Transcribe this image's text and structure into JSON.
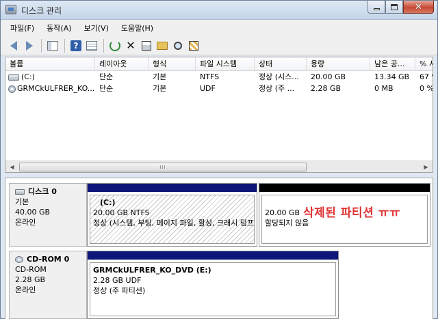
{
  "window": {
    "title": "디스크 관리"
  },
  "menu": [
    "파일(F)",
    "동작(A)",
    "보기(V)",
    "도움말(H)"
  ],
  "toolbar": {
    "icons": [
      "back-arrow-icon",
      "forward-arrow-icon",
      "console-tree-icon",
      "help-icon",
      "details-pane-icon",
      "refresh-icon",
      "delete-icon",
      "properties-icon",
      "open-icon",
      "explore-icon",
      "extend-icon"
    ]
  },
  "volume_table": {
    "columns": [
      "볼륨",
      "레이아웃",
      "형식",
      "파일 시스템",
      "상태",
      "용량",
      "남은 공...",
      "% 사용 가능"
    ],
    "rows": [
      [
        "(C:)",
        "단순",
        "기본",
        "NTFS",
        "정상 (시스...",
        "20.00 GB",
        "13.34 GB",
        "67 %"
      ],
      [
        "GRMCkULFRER_KO...",
        "단순",
        "기본",
        "UDF",
        "정상 (주 ...",
        "2.28 GB",
        "0 MB",
        "0 %"
      ]
    ],
    "scroll_thumb_label": "III"
  },
  "disks": [
    {
      "name": "디스크 0",
      "type": "기본",
      "size": "40.00 GB",
      "status": "온라인",
      "partitions": [
        {
          "title": "(C:)",
          "size": "20.00 GB NTFS",
          "status": "정상 (시스템, 부팅, 페이지 파일, 활성, 크래시 덤프, 주 파티션)"
        },
        {
          "size": "20.00 GB",
          "status": "할당되지 않음"
        }
      ]
    },
    {
      "name": "CD-ROM 0",
      "type": "CD-ROM",
      "size": "2.28 GB",
      "status": "온라인",
      "partitions": [
        {
          "title": "GRMCkULFRER_KO_DVD  (E:)",
          "size": "2.28 GB UDF",
          "status": "정상 (주 파티션)"
        }
      ]
    }
  ],
  "annotation": "삭제된 파티션 ㅠㅠ",
  "colors": {
    "primary_bar": "#0f167a",
    "unallocated_bar": "#000000",
    "annotation": "#e03232"
  }
}
